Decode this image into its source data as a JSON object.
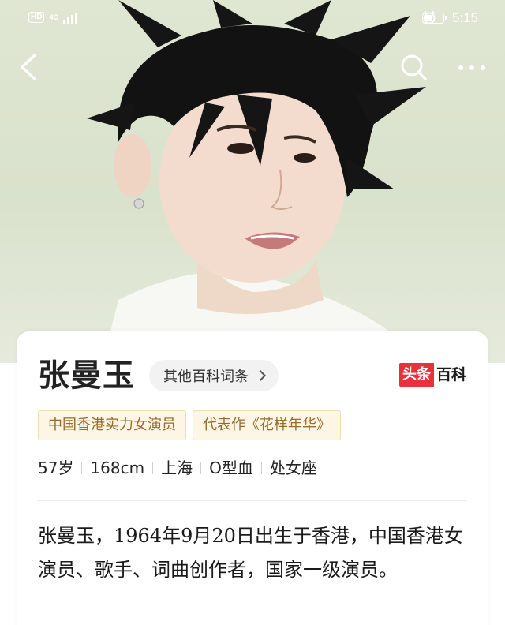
{
  "status_bar": {
    "hd_label": "HD",
    "network_label": "4G",
    "time": "5:15"
  },
  "nav": {
    "back_icon": "chevron-left-icon",
    "search_icon": "search-icon",
    "more_icon": "more-horizontal-icon"
  },
  "entry": {
    "name": "张曼玉",
    "other_entries_label": "其他百科词条",
    "brand_part1": "头条",
    "brand_part2": "百科",
    "tags": [
      "中国香港实力女演员",
      "代表作《花样年华》"
    ],
    "facts": [
      "57岁",
      "168cm",
      "上海",
      "O型血",
      "处女座"
    ],
    "summary": "张曼玉，1964年9月20日出生于香港，中国香港女演员、歌手、词曲创作者，国家一级演员。"
  },
  "colors": {
    "brand_red": "#e8313b",
    "tag_bg": "#fdf6e4",
    "tag_text": "#9a6a2c",
    "hero_bg": "#dfe6d2"
  }
}
